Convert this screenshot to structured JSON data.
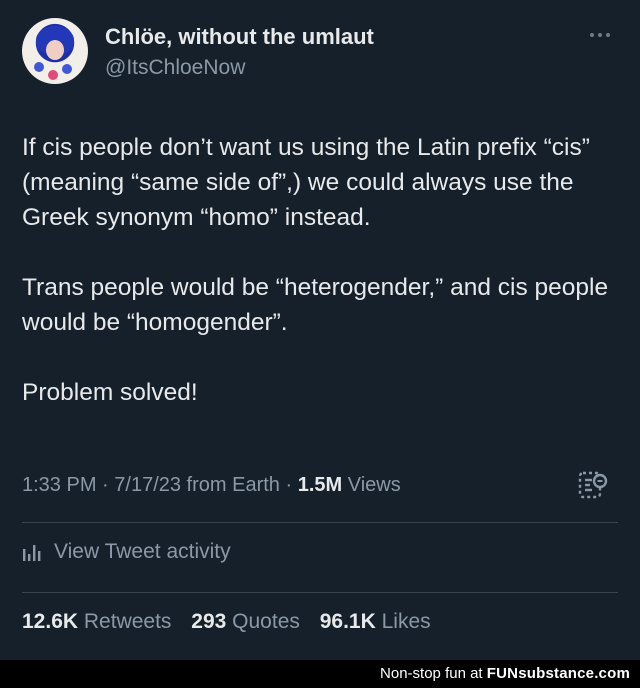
{
  "author": {
    "display_name": "Chlöe, without the umlaut",
    "handle": "@ItsChloeNow"
  },
  "tweet": {
    "paragraphs": [
      "If cis people don’t want us using the Latin prefix “cis” (meaning “same side of”,) we could always use the Greek synonym “homo” instead.",
      "Trans people would be “heterogender,” and cis people would be “homogender”.",
      "Problem solved!"
    ]
  },
  "meta": {
    "time": "1:33 PM",
    "sep1": " · ",
    "date": "7/17/23",
    "source": " from Earth",
    "sep2": " · ",
    "views_count": "1.5M",
    "views_label": " Views"
  },
  "activity": {
    "label": "View Tweet activity"
  },
  "stats": {
    "retweets_count": "12.6K",
    "retweets_label": "Retweets",
    "quotes_count": "293",
    "quotes_label": "Quotes",
    "likes_count": "96.1K",
    "likes_label": "Likes"
  },
  "watermark": {
    "text": "Non-stop fun at ",
    "brand": "FUNsubstance.com"
  },
  "icons": {
    "more": "more-horizontal-icon",
    "translate": "translate-icon",
    "analytics": "analytics-bars-icon"
  },
  "colors": {
    "background": "#15202b",
    "text_primary": "#e7e9ea",
    "text_secondary": "#8b98a5",
    "divider": "#38444d"
  }
}
